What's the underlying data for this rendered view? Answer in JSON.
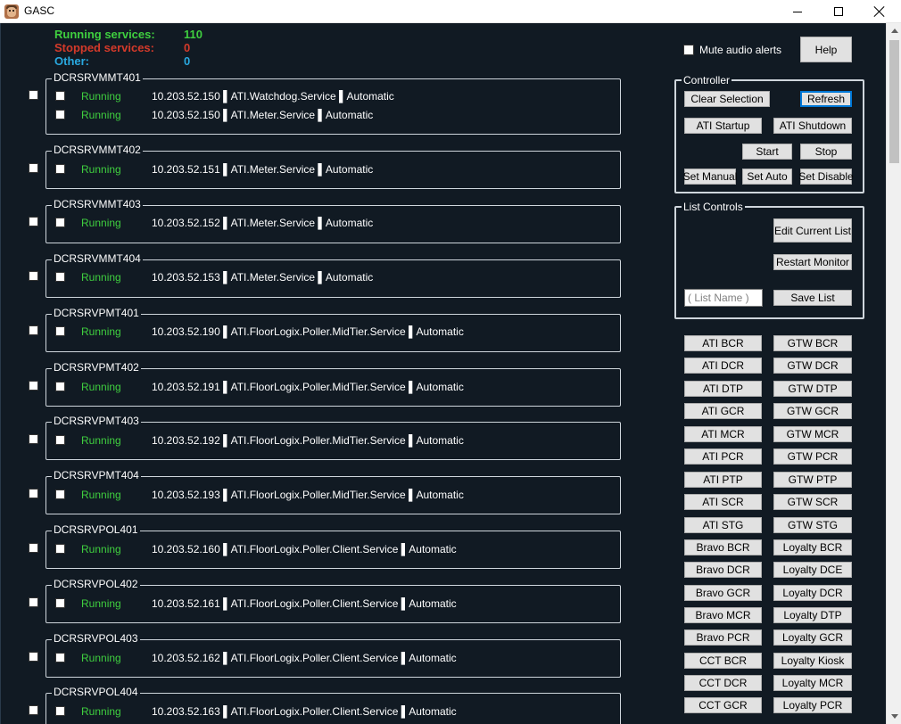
{
  "window": {
    "title": "GASC"
  },
  "summary": {
    "running_label": "Running services:",
    "running_value": "110",
    "stopped_label": "Stopped services:",
    "stopped_value": "0",
    "other_label": "Other:",
    "other_value": "0"
  },
  "servers": [
    {
      "name": "DCRSRVMMT401",
      "services": [
        {
          "status": "Running",
          "detail": "10.203.52.150 ▌ATI.Watchdog.Service ▌Automatic"
        },
        {
          "status": "Running",
          "detail": "10.203.52.150 ▌ATI.Meter.Service ▌Automatic"
        }
      ]
    },
    {
      "name": "DCRSRVMMT402",
      "services": [
        {
          "status": "Running",
          "detail": "10.203.52.151 ▌ATI.Meter.Service ▌Automatic"
        }
      ]
    },
    {
      "name": "DCRSRVMMT403",
      "services": [
        {
          "status": "Running",
          "detail": "10.203.52.152 ▌ATI.Meter.Service ▌Automatic"
        }
      ]
    },
    {
      "name": "DCRSRVMMT404",
      "services": [
        {
          "status": "Running",
          "detail": "10.203.52.153 ▌ATI.Meter.Service ▌Automatic"
        }
      ]
    },
    {
      "name": "DCRSRVPMT401",
      "services": [
        {
          "status": "Running",
          "detail": "10.203.52.190 ▌ATI.FloorLogix.Poller.MidTier.Service ▌Automatic"
        }
      ]
    },
    {
      "name": "DCRSRVPMT402",
      "services": [
        {
          "status": "Running",
          "detail": "10.203.52.191 ▌ATI.FloorLogix.Poller.MidTier.Service ▌Automatic"
        }
      ]
    },
    {
      "name": "DCRSRVPMT403",
      "services": [
        {
          "status": "Running",
          "detail": "10.203.52.192 ▌ATI.FloorLogix.Poller.MidTier.Service ▌Automatic"
        }
      ]
    },
    {
      "name": "DCRSRVPMT404",
      "services": [
        {
          "status": "Running",
          "detail": "10.203.52.193 ▌ATI.FloorLogix.Poller.MidTier.Service ▌Automatic"
        }
      ]
    },
    {
      "name": "DCRSRVPOL401",
      "services": [
        {
          "status": "Running",
          "detail": "10.203.52.160 ▌ATI.FloorLogix.Poller.Client.Service ▌Automatic"
        }
      ]
    },
    {
      "name": "DCRSRVPOL402",
      "services": [
        {
          "status": "Running",
          "detail": "10.203.52.161 ▌ATI.FloorLogix.Poller.Client.Service ▌Automatic"
        }
      ]
    },
    {
      "name": "DCRSRVPOL403",
      "services": [
        {
          "status": "Running",
          "detail": "10.203.52.162 ▌ATI.FloorLogix.Poller.Client.Service ▌Automatic"
        }
      ]
    },
    {
      "name": "DCRSRVPOL404",
      "services": [
        {
          "status": "Running",
          "detail": "10.203.52.163 ▌ATI.FloorLogix.Poller.Client.Service ▌Automatic"
        }
      ]
    }
  ],
  "controls": {
    "mute_label": "Mute audio alerts",
    "help": "Help",
    "controller_title": "Controller",
    "clear_selection": "Clear Selection",
    "refresh": "Refresh",
    "ati_startup": "ATI Startup",
    "ati_shutdown": "ATI Shutdown",
    "start": "Start",
    "stop": "Stop",
    "set_manual": "Set Manual",
    "set_auto": "Set Auto",
    "set_disable": "Set Disable",
    "list_controls_title": "List Controls",
    "edit_current_list": "Edit Current List",
    "restart_monitor": "Restart Monitor",
    "list_name_value": "( List Name )",
    "save_list": "Save List"
  },
  "list_buttons": {
    "left": [
      "ATI BCR",
      "ATI DCR",
      "ATI DTP",
      "ATI GCR",
      "ATI MCR",
      "ATI PCR",
      "ATI PTP",
      "ATI SCR",
      "ATI STG",
      "Bravo BCR",
      "Bravo DCR",
      "Bravo GCR",
      "Bravo MCR",
      "Bravo PCR",
      "CCT BCR",
      "CCT DCR",
      "CCT GCR"
    ],
    "right": [
      "GTW BCR",
      "GTW DCR",
      "GTW DTP",
      "GTW GCR",
      "GTW MCR",
      "GTW PCR",
      "GTW PTP",
      "GTW SCR",
      "GTW STG",
      "Loyalty BCR",
      "Loyalty DCE",
      "Loyalty DCR",
      "Loyalty DTP",
      "Loyalty GCR",
      "Loyalty Kiosk",
      "Loyalty MCR",
      "Loyalty PCR"
    ]
  }
}
